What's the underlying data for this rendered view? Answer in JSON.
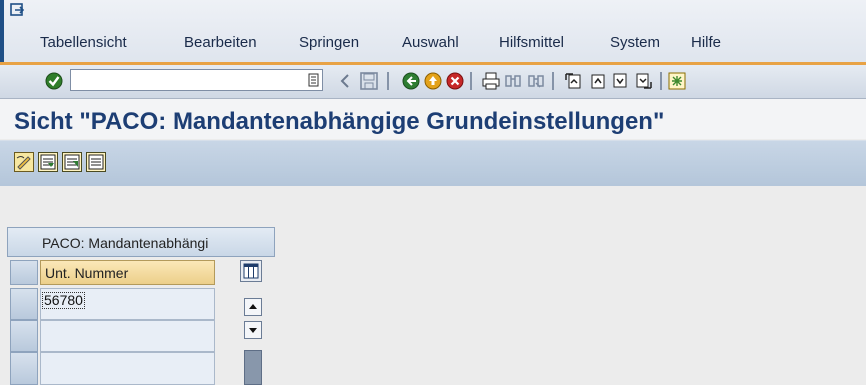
{
  "menu": {
    "items": [
      {
        "label": "Tabellensicht"
      },
      {
        "label": "Bearbeiten"
      },
      {
        "label": "Springen"
      },
      {
        "label": "Auswahl"
      },
      {
        "label": "Hilfsmittel"
      },
      {
        "label": "System"
      },
      {
        "label": "Hilfe"
      }
    ]
  },
  "toolbar": {
    "command_value": "",
    "icons": [
      "enter-icon",
      "history-dropdown-icon",
      "back-arrow-icon",
      "save-icon",
      "back-icon",
      "exit-icon",
      "cancel-icon",
      "print-icon",
      "find-icon",
      "find-next-icon",
      "first-page-icon",
      "previous-page-icon",
      "next-page-icon",
      "last-page-icon",
      "layout-icon"
    ]
  },
  "title": "Sicht \"PACO: Mandantenabhängige Grundeinstellungen\"",
  "app_toolbar": {
    "icons": [
      "change-display-icon",
      "select-all-icon",
      "deselect-icon",
      "details-icon"
    ]
  },
  "table": {
    "title": "PACO: Mandantenabhängi",
    "column_header": "Unt. Nummer",
    "rows": [
      "56780",
      "",
      ""
    ]
  },
  "colors": {
    "title": "#1d3e74",
    "accent_line": "#e8a245",
    "app_toolbar": "#b4c6da"
  }
}
